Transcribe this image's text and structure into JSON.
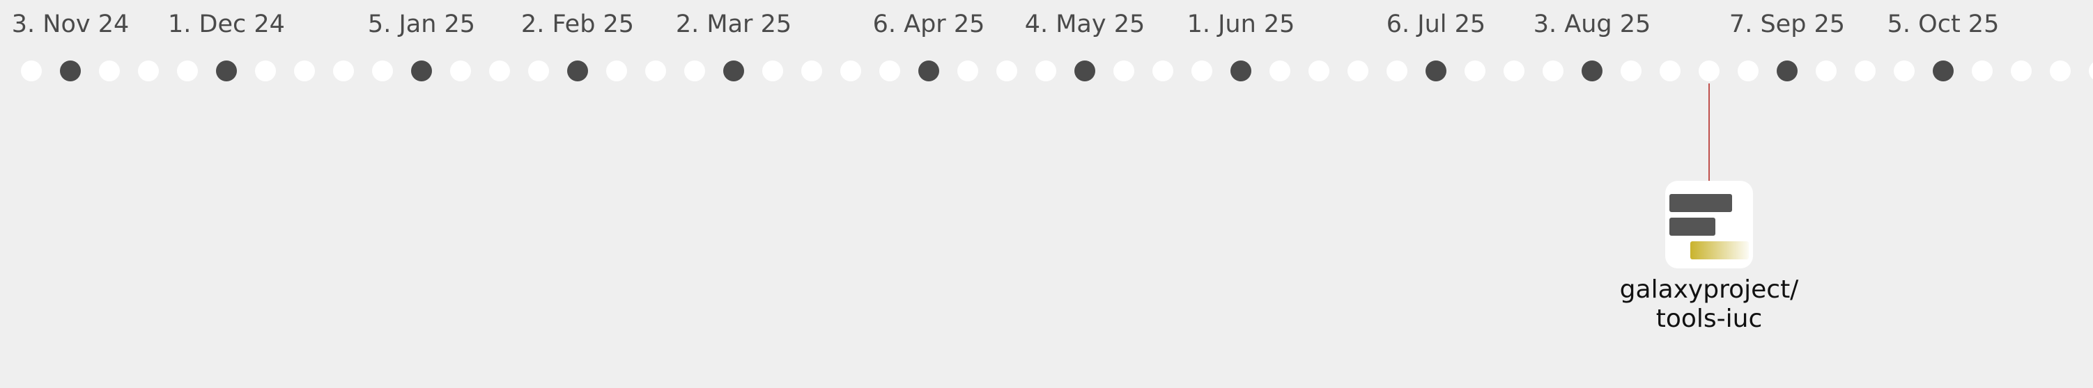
{
  "timeline": {
    "month_labels": [
      "3. Nov 24",
      "1. Dec 24",
      "5. Jan 25",
      "2. Feb 25",
      "2. Mar 25",
      "6. Apr 25",
      "4. May 25",
      "1. Jun 25",
      "6. Jul 25",
      "3. Aug 25",
      "7. Sep 25",
      "5. Oct 25"
    ],
    "dots_count": 54,
    "filled_dot_indices": [
      1,
      5,
      10,
      14,
      18,
      23,
      27,
      31,
      36,
      40,
      45,
      49
    ],
    "event_dot_index": 44,
    "colors": {
      "background": "#efefef",
      "dot_empty": "#ffffff",
      "dot_filled": "#4a4a4a",
      "connector": "#c0504d",
      "icon_bar": "#555555",
      "icon_accent": "#c9b32d",
      "label_text": "#4a4a4a"
    }
  },
  "repo": {
    "icon": "repository-icon",
    "name_line1": "galaxyproject/",
    "name_line2": "tools-iuc"
  }
}
